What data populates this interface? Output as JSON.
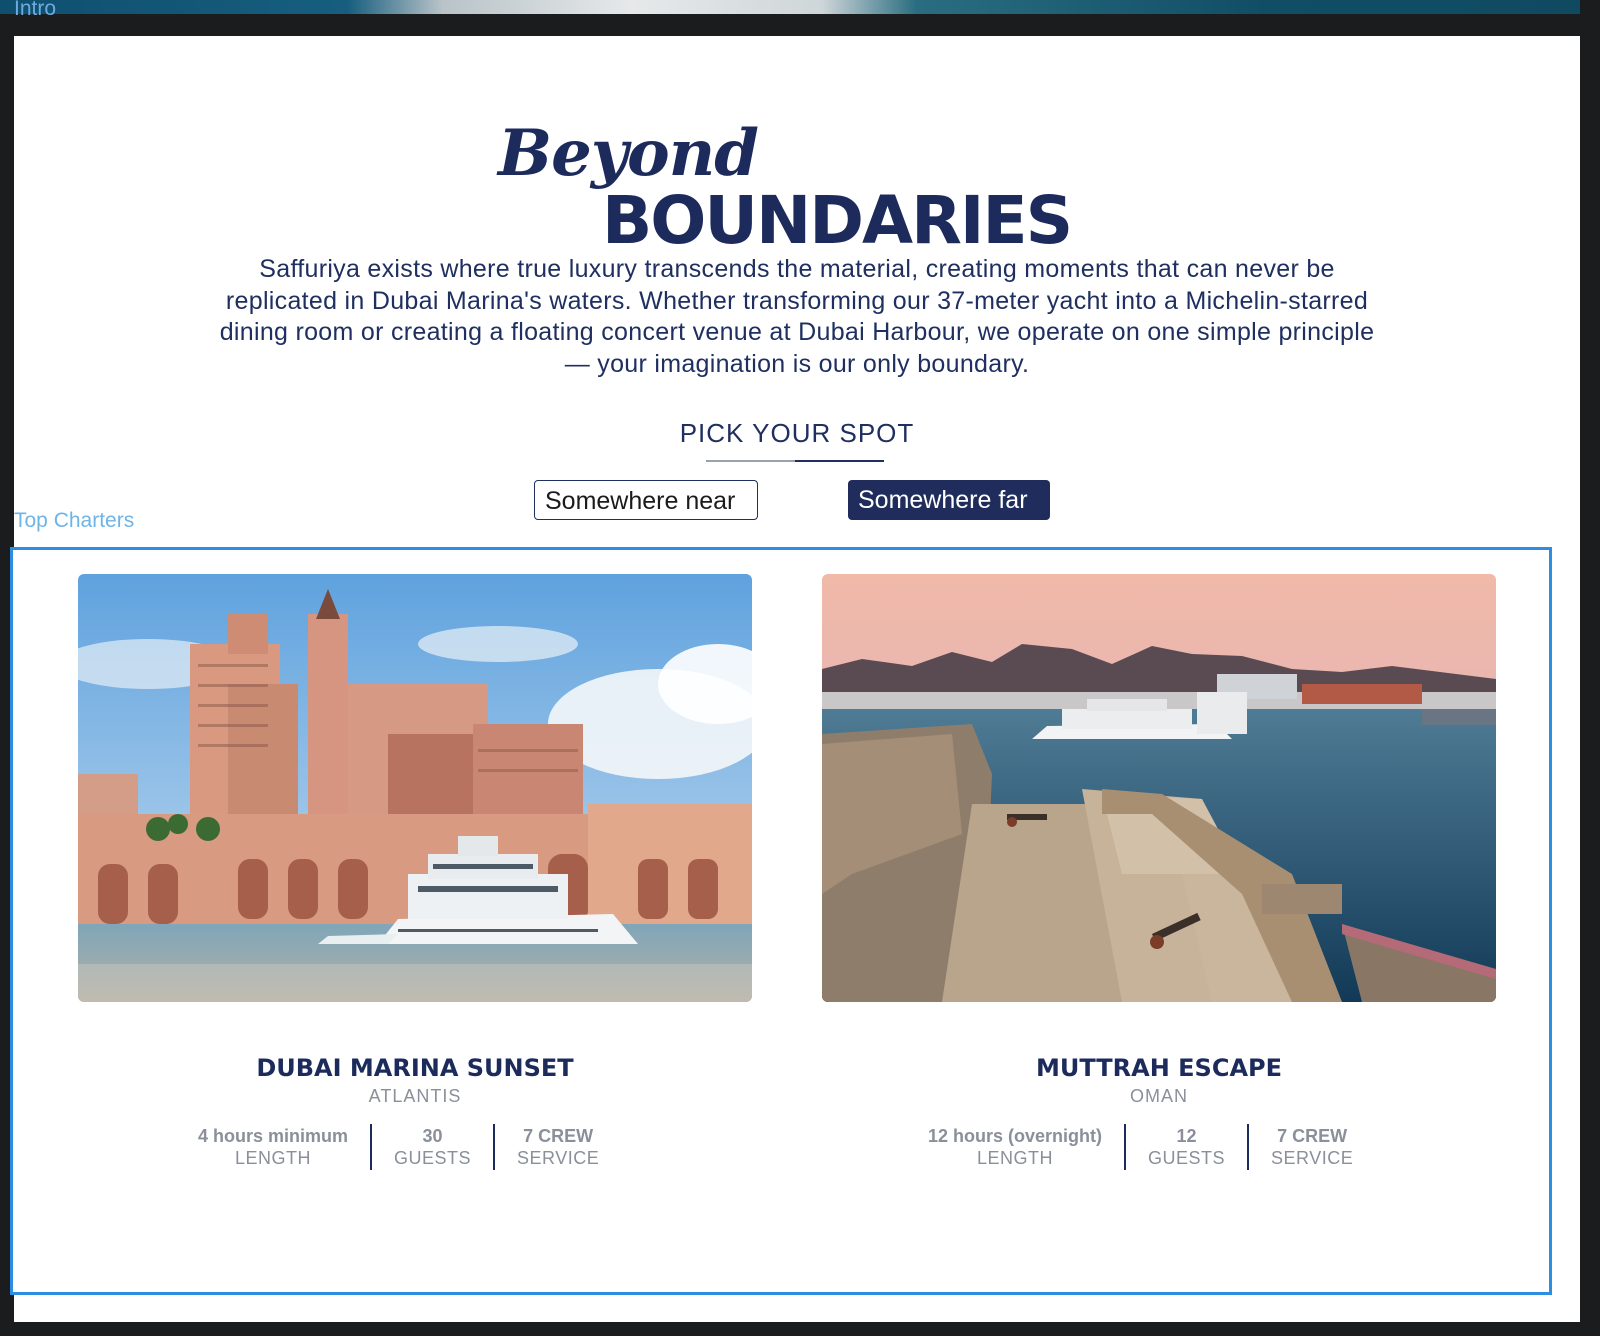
{
  "intro_section": {
    "label": "Intro"
  },
  "hero": {
    "title_script": "Beyond",
    "title_caps": "BOUNDARIES",
    "description": "Saffuriya exists where true luxury transcends the material, creating moments that can never be replicated in Dubai Marina's waters. Whether transforming our 37-meter yacht into a Michelin-starred dining room or creating a floating concert venue at Dubai Harbour, we operate on one simple principle — your imagination is our only boundary."
  },
  "spot_picker": {
    "heading": "PICK YOUR SPOT",
    "options": [
      {
        "label": "Somewhere near",
        "selected": false
      },
      {
        "label": "Somewhere far",
        "selected": true
      }
    ]
  },
  "top_charters": {
    "label": "Top Charters",
    "cards": [
      {
        "title": "DUBAI MARINA SUNSET",
        "location": "ATLANTIS",
        "image": "atlantis-yacht-photo",
        "stats": [
          {
            "value": "4 hours minimum",
            "label": "LENGTH"
          },
          {
            "value": "30",
            "label": "GUESTS"
          },
          {
            "value": "7 CREW",
            "label": "SERVICE"
          }
        ]
      },
      {
        "title": "MUTTRAH ESCAPE",
        "location": "OMAN",
        "image": "muttrah-fort-harbour-photo",
        "stats": [
          {
            "value": "12 hours (overnight)",
            "label": "LENGTH"
          },
          {
            "value": "12",
            "label": "GUESTS"
          },
          {
            "value": "7 CREW",
            "label": "SERVICE"
          }
        ]
      }
    ]
  },
  "colors": {
    "navy": "#1c2b5c",
    "selection_blue": "#2d8de0",
    "muted_text": "#8a8f99",
    "label_blue": "#6fb4e8"
  }
}
